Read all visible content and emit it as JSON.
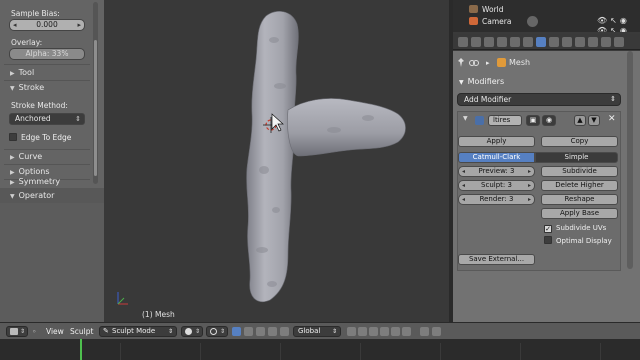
{
  "tool_shelf": {
    "sample_bias_label": "Sample Bias:",
    "sample_bias_value": "0.000",
    "overlay_label": "Overlay:",
    "overlay_value": "Alpha: 33%",
    "panels": {
      "tool": "Tool",
      "stroke": "Stroke",
      "curve": "Curve",
      "options": "Options",
      "symmetry": "Symmetry",
      "operator": "Operator"
    },
    "stroke_method_label": "Stroke Method:",
    "stroke_method_value": "Anchored",
    "edge_to_edge_label": "Edge To Edge",
    "edge_to_edge_checked": false
  },
  "viewport": {
    "object_label": "(1) Mesh"
  },
  "outliner": {
    "rows": [
      {
        "label": "World",
        "icon": "world-icon"
      },
      {
        "label": "Camera",
        "icon": "camera-icon"
      }
    ]
  },
  "properties": {
    "breadcrumb": "Mesh",
    "panel_title": "Modifiers",
    "add_modifier": "Add Modifier",
    "modifier": {
      "name": "ltires",
      "apply_label": "Apply",
      "copy_label": "Copy",
      "type_options": [
        "Catmull-Clark",
        "Simple"
      ],
      "selected_type": "Catmull-Clark",
      "subdivide_label": "Subdivide",
      "delete_higher_label": "Delete Higher",
      "reshape_label": "Reshape",
      "apply_base_label": "Apply Base",
      "subdivide_uvs_label": "Subdivide UVs",
      "subdivide_uvs_checked": true,
      "optimal_display_label": "Optimal Display",
      "optimal_display_checked": false,
      "preview_label": "Preview: 3",
      "sculpt_label": "Sculpt: 3",
      "render_label": "Render: 3",
      "save_external_label": "Save External..."
    }
  },
  "bottom_bar": {
    "view_label": "View",
    "sculpt_menu_label": "Sculpt",
    "mode": "Sculpt Mode",
    "orientation": "Global"
  },
  "colors": {
    "accent": "#5680c2",
    "mesh": "#a7a8b0",
    "timeline_cursor": "#4ec04e"
  }
}
